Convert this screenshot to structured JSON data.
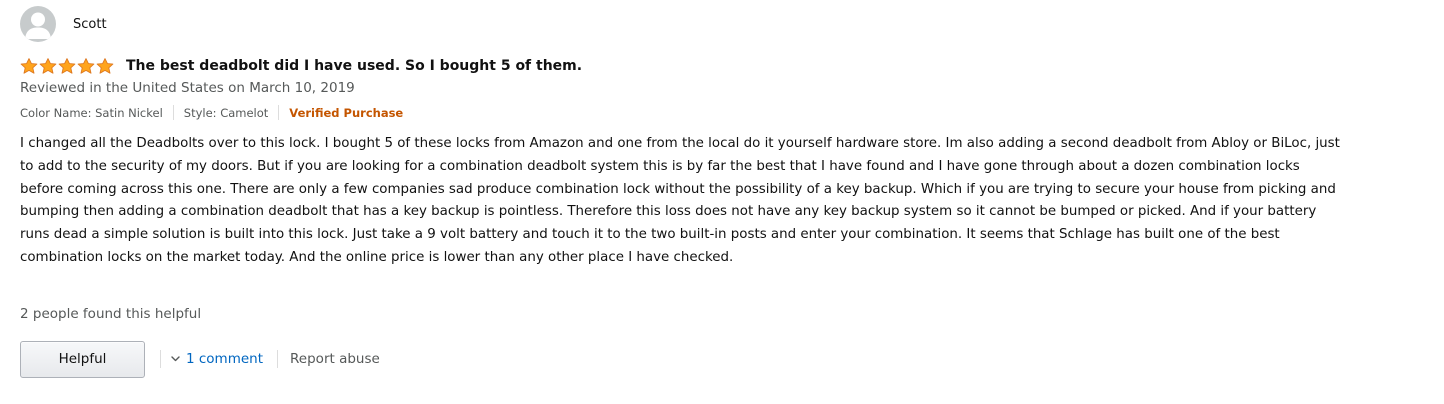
{
  "review": {
    "profile": {
      "name": "Scott",
      "avatar_icon": "default-user-avatar-icon"
    },
    "rating": {
      "stars": 5,
      "max": 5,
      "star_color": "#ffa41c",
      "star_outline": "#de7921"
    },
    "title": "The best deadbolt did I have used. So I bought 5 of them.",
    "date_line": "Reviewed in the United States on March 10, 2019",
    "format": {
      "color_name": "Color Name: Satin Nickel",
      "style": "Style: Camelot",
      "verified": "Verified Purchase",
      "verified_color": "#c45500"
    },
    "body": "I changed all the Deadbolts over to this lock. I bought 5 of these locks from Amazon and one from the local do it yourself hardware store. Im also adding a second deadbolt from Abloy or BiLoc, just to add to the security of my doors. But if you are looking for a combination deadbolt system this is by far the best that I have found and I have gone through about a dozen combination locks before coming across this one. There are only a few companies sad produce combination lock without the possibility of a key backup. Which if you are trying to secure your house from picking and bumping then adding a combination deadbolt that has a key backup is pointless. Therefore this loss does not have any key backup system so it cannot be bumped or picked. And if your battery runs dead a simple solution is built into this lock. Just take a 9 volt battery and touch it to the two built-in posts and enter your combination. It seems that Schlage has built one of the best combination locks on the market today. And the online price is lower than any other place I have checked.",
    "helpful_count": "2 people found this helpful",
    "actions": {
      "helpful_label": "Helpful",
      "comments_label": "1 comment",
      "comments_icon": "chevron-down-icon",
      "report_label": "Report abuse",
      "link_color": "#0066c0"
    }
  }
}
